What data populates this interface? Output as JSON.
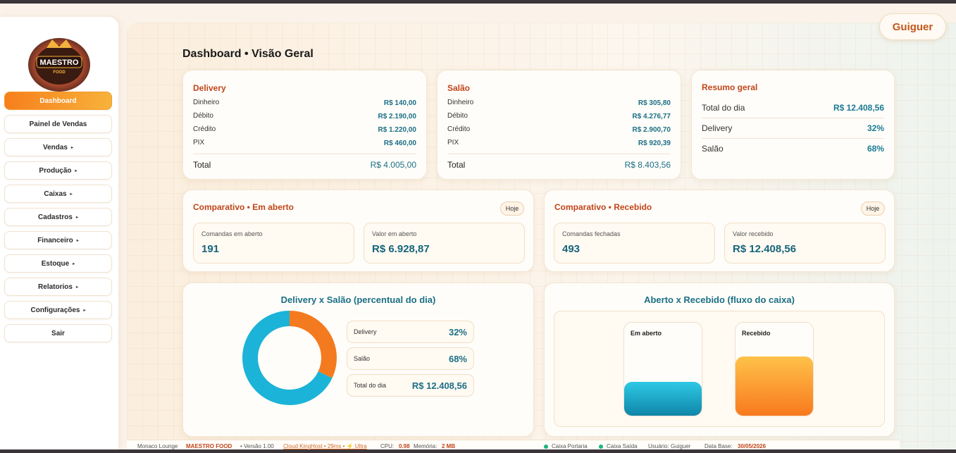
{
  "user": {
    "name": "Guiguer"
  },
  "logo": {
    "line1": "MAESTRO",
    "line2": "FOOD"
  },
  "sidebar": {
    "items": [
      {
        "label": "Dashboard",
        "has_submenu": false,
        "active": true
      },
      {
        "label": "Painel de Vendas",
        "has_submenu": false
      },
      {
        "label": "Vendas",
        "has_submenu": true
      },
      {
        "label": "Produção",
        "has_submenu": true
      },
      {
        "label": "Caixas",
        "has_submenu": true
      },
      {
        "label": "Cadastros",
        "has_submenu": true
      },
      {
        "label": "Financeiro",
        "has_submenu": true
      },
      {
        "label": "Estoque",
        "has_submenu": true
      },
      {
        "label": "Relatorios",
        "has_submenu": true
      },
      {
        "label": "Configurações",
        "has_submenu": true
      },
      {
        "label": "Sair",
        "has_submenu": false
      }
    ],
    "caret": "▸"
  },
  "page": {
    "title": "Dashboard • Visão Geral"
  },
  "delivery": {
    "title": "Delivery",
    "rows": [
      {
        "label": "Dinheiro",
        "value": "R$ 140,00"
      },
      {
        "label": "Débito",
        "value": "R$ 2.190,00"
      },
      {
        "label": "Crédito",
        "value": "R$ 1.220,00"
      },
      {
        "label": "PIX",
        "value": "R$ 460,00"
      }
    ],
    "total_label": "Total",
    "total_value": "R$ 4.005,00"
  },
  "salao": {
    "title": "Salão",
    "rows": [
      {
        "label": "Dinheiro",
        "value": "R$ 305,80"
      },
      {
        "label": "Débito",
        "value": "R$ 4.276,77"
      },
      {
        "label": "Crédito",
        "value": "R$ 2.900,70"
      },
      {
        "label": "PIX",
        "value": "R$ 920,39"
      }
    ],
    "total_label": "Total",
    "total_value": "R$ 8.403,56"
  },
  "resumo": {
    "title": "Resumo geral",
    "rows": [
      {
        "label": "Total do dia",
        "value": "R$ 12.408,56"
      },
      {
        "label": "Delivery",
        "value": "32%"
      },
      {
        "label": "Salão",
        "value": "68%"
      }
    ]
  },
  "comparativo_aberto": {
    "title": "Comparativo • Em aberto",
    "badge": "Hoje",
    "stats": [
      {
        "label": "Comandas em aberto",
        "value": "191"
      },
      {
        "label": "Valor em aberto",
        "value": "R$ 6.928,87"
      }
    ]
  },
  "comparativo_recebido": {
    "title": "Comparativo • Recebido",
    "badge": "Hoje",
    "stats": [
      {
        "label": "Comandas fechadas",
        "value": "493"
      },
      {
        "label": "Valor recebido",
        "value": "R$ 12.408,56"
      }
    ]
  },
  "donut": {
    "title": "Delivery x Salão (percentual do dia)",
    "legend": [
      {
        "label": "Delivery",
        "value": "32%"
      },
      {
        "label": "Salão",
        "value": "68%"
      },
      {
        "label": "Total do dia",
        "value": "R$ 12.408,56"
      }
    ],
    "colors": {
      "delivery": "#f47a1f",
      "salao": "#1cb3d8"
    }
  },
  "flow": {
    "title": "Aberto x Recebido (fluxo do caixa)",
    "bars": [
      {
        "label": "Em aberto",
        "fill_fraction": 0.36
      },
      {
        "label": "Recebido",
        "fill_fraction": 0.63
      }
    ]
  },
  "chart_data": [
    {
      "type": "pie",
      "title": "Delivery x Salão (percentual do dia)",
      "categories": [
        "Delivery",
        "Salão"
      ],
      "values": [
        32,
        68
      ]
    },
    {
      "type": "bar",
      "title": "Aberto x Recebido (fluxo do caixa)",
      "categories": [
        "Em aberto",
        "Recebido"
      ],
      "values": [
        6928.87,
        12408.56
      ]
    }
  ],
  "footer": {
    "store": "Monaco Lounge",
    "brand": "MAESTRO FOOD",
    "version": "• Versão 1.00",
    "host": "Cloud KingHost • 29ms • ⚡ Ultra",
    "cpu_label": "CPU:",
    "cpu_value": "0.98",
    "mem_label": "Memória:",
    "mem_value": "2 MB",
    "caixa_portaria": "Caixa Portaria",
    "caixa_saida": "Caixa Saída",
    "usuario": "Usuário: Guiguer",
    "data_base_label": "Data Base:",
    "data_base_value": "30/05/2026"
  }
}
